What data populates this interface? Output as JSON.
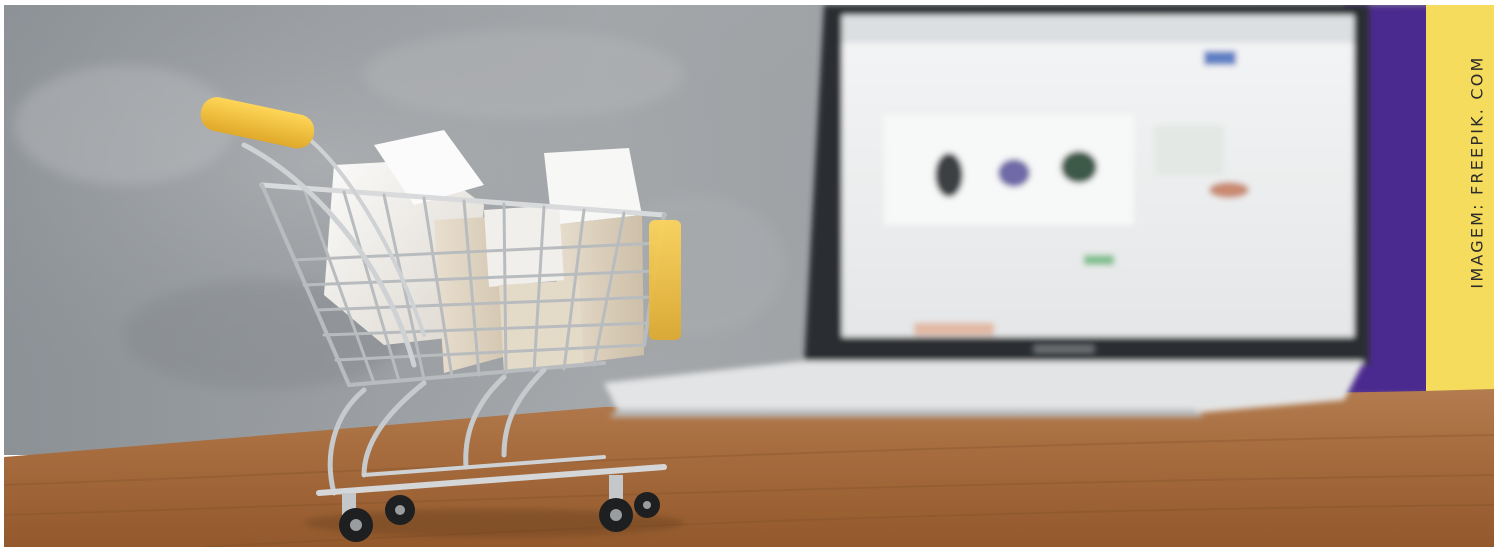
{
  "image": {
    "subject": "miniature-shopping-cart-with-boxes",
    "credit_text": "IMAGEM:  FREEPIK. COM"
  },
  "colors": {
    "wall": "#8f9397",
    "table": "#a4683a",
    "cart_handle": "#f2c23e",
    "laptop_screen": "#eef0f1",
    "purple_panel": "#4b2a8f",
    "yellow_panel": "#f6dc5c"
  }
}
